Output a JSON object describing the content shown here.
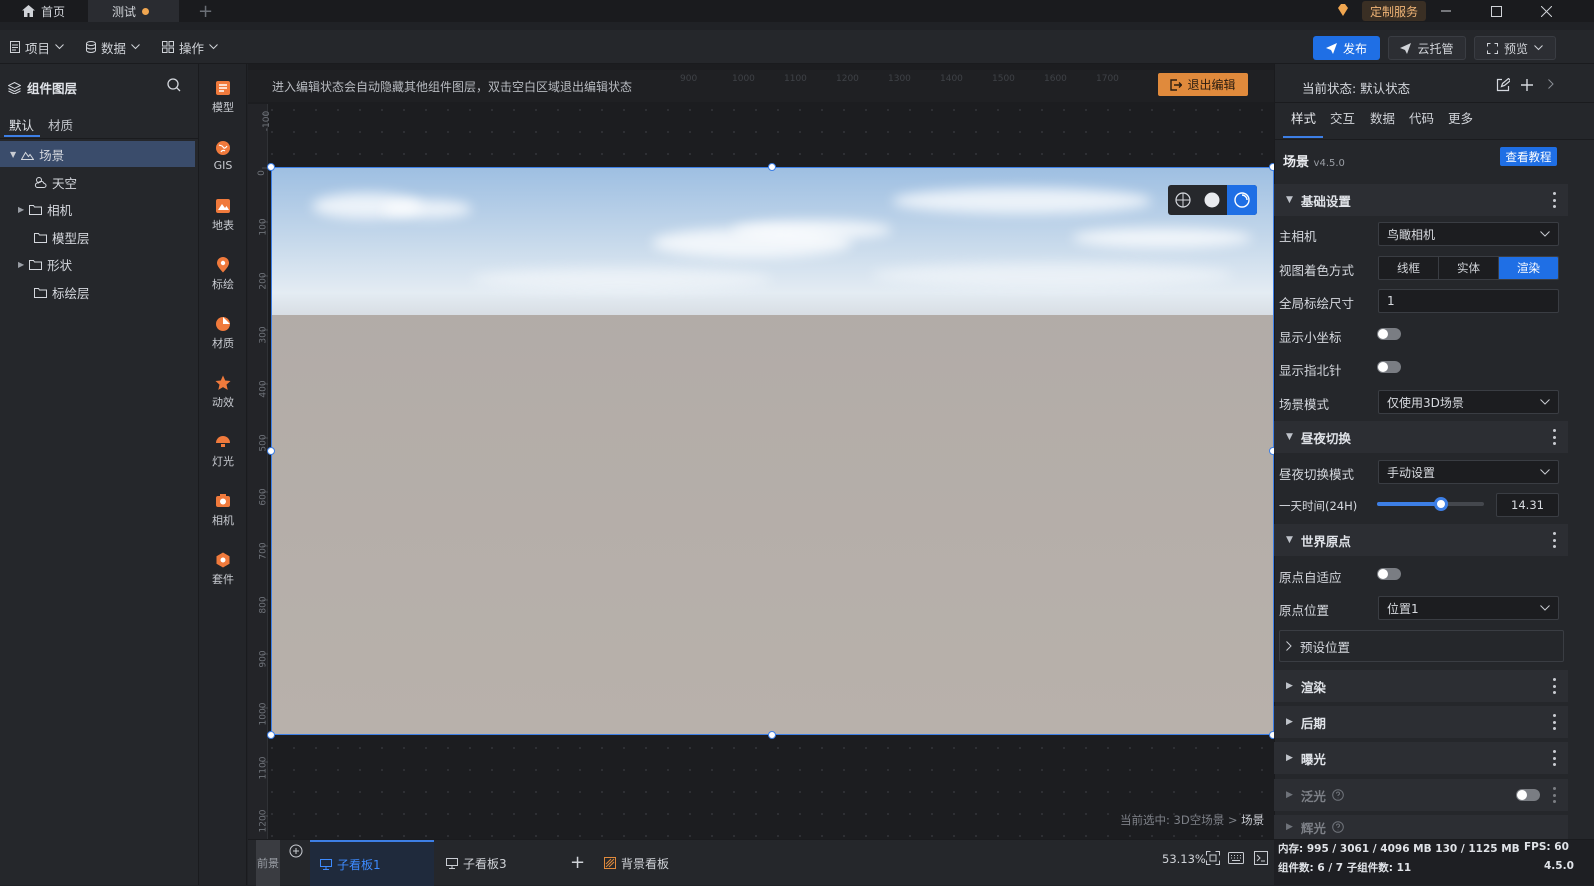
{
  "titlebar": {
    "tabs": [
      {
        "label": "首页"
      },
      {
        "label": "测试"
      }
    ],
    "service_label": "定制服务"
  },
  "menubar": {
    "menus": [
      {
        "label": "项目"
      },
      {
        "label": "数据"
      },
      {
        "label": "操作"
      }
    ],
    "publish_label": "发布",
    "cloud_label": "云托管",
    "preview_label": "预览"
  },
  "layers": {
    "title": "组件图层",
    "tabs": [
      "默认",
      "材质"
    ],
    "tree": [
      {
        "label": "场景"
      },
      {
        "label": "天空"
      },
      {
        "label": "相机"
      },
      {
        "label": "模型层"
      },
      {
        "label": "形状"
      },
      {
        "label": "标绘层"
      }
    ]
  },
  "categories": [
    {
      "label": "模型"
    },
    {
      "label": "GIS"
    },
    {
      "label": "地表"
    },
    {
      "label": "标绘"
    },
    {
      "label": "材质"
    },
    {
      "label": "动效"
    },
    {
      "label": "灯光"
    },
    {
      "label": "相机"
    },
    {
      "label": "套件"
    }
  ],
  "canvas": {
    "hint": "进入编辑状态会自动隐藏其他组件图层，双击空白区域退出编辑状态",
    "exit_label": "退出编辑",
    "selection_path": "当前选中: 3D空场景 > ",
    "selection_current": "场景",
    "ruler_top": [
      "900",
      "1000",
      "1100",
      "1200",
      "1300",
      "1400",
      "1500",
      "1600",
      "1700"
    ],
    "ruler_left": [
      "-100",
      "0",
      "100",
      "200",
      "300",
      "400",
      "500",
      "600",
      "700",
      "800",
      "900",
      "1000",
      "1100",
      "1200"
    ]
  },
  "bottombar": {
    "front_label": "前景",
    "tabs": [
      {
        "label": "子看板1"
      },
      {
        "label": "子看板3"
      },
      {
        "label": "背景看板"
      }
    ],
    "zoom": "53.13%"
  },
  "props": {
    "state_label": "当前状态: 默认状态",
    "tabs": [
      "样式",
      "交互",
      "数据",
      "代码",
      "更多"
    ],
    "component_name": "场景",
    "version": "v4.5.0",
    "tutorial_label": "查看教程",
    "sections": {
      "basic": "基础设置",
      "daynight": "昼夜切换",
      "origin": "世界原点",
      "render": "渲染",
      "post": "后期",
      "exposure": "曝光",
      "bloom": "泛光",
      "glow": "辉光"
    },
    "main_camera": {
      "label": "主相机",
      "value": "鸟瞰相机"
    },
    "shading": {
      "label": "视图着色方式",
      "options": [
        "线框",
        "实体",
        "渲染"
      ],
      "selected": "渲染"
    },
    "marker_size": {
      "label": "全局标绘尺寸",
      "value": "1"
    },
    "show_axis": {
      "label": "显示小坐标"
    },
    "show_compass": {
      "label": "显示指北针"
    },
    "scene_mode": {
      "label": "场景模式",
      "value": "仅使用3D场景"
    },
    "daynight_mode": {
      "label": "昼夜切换模式",
      "value": "手动设置"
    },
    "day_time": {
      "label": "一天时间(24H)",
      "value": "14.31",
      "fraction": 0.6
    },
    "origin_adapt": {
      "label": "原点自适应"
    },
    "origin_pos": {
      "label": "原点位置",
      "value": "位置1"
    },
    "preset_pos": "预设位置"
  },
  "status": {
    "memory": "内存:  995 / 3061 / 4096 MB  130 / 1125 MB",
    "fps": "FPS:  60",
    "components": "组件数: 6 / 7   子组件数: 11",
    "ver": "4.5.0"
  }
}
